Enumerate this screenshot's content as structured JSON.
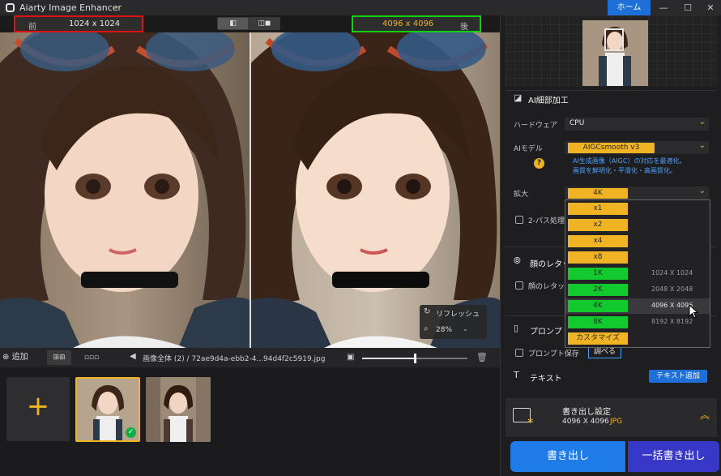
{
  "app": {
    "title": "Aiarty Image Enhancer",
    "home": "ホーム"
  },
  "compare": {
    "before_label": "前",
    "before_res": "1024 x 1024",
    "after_res": "4096 x 4096",
    "after_label": "後"
  },
  "preview": {
    "refresh": "リフレッシュ",
    "zoom": "28%"
  },
  "toolbar": {
    "add": "追加",
    "path": "画像全体 (2)  /  72ae9d4a-ebb2-4...94d4f2c5919.jpg",
    "zoom_slider_fraction": 0.5
  },
  "panel": {
    "ai_section": "AI細部加工",
    "hardware_label": "ハードウェア",
    "hardware_value": "CPU",
    "model_label": "AIモデル",
    "model_value": "AIGCsmooth  v3",
    "model_desc_1": "AI生成画像（AIGC）の対応を最適化。",
    "model_desc_2": "画質を鮮明化・平滑化・高画質化。",
    "scale_label": "拡大",
    "scale_value": "4K",
    "twopass_label": "2-パス処理",
    "face_section": "顔のレタッチ",
    "face_checkbox": "顔のレタッチ",
    "prompt_section": "プロンプト",
    "prompt_save": "プロンプト保存",
    "search": "調べる",
    "text_section": "テキスト",
    "text_add": "テキスト追加"
  },
  "scale_options": [
    {
      "label": "x1",
      "res": "",
      "color": "y"
    },
    {
      "label": "x2",
      "res": "",
      "color": "y"
    },
    {
      "label": "x4",
      "res": "",
      "color": "y"
    },
    {
      "label": "x8",
      "res": "",
      "color": "y"
    },
    {
      "label": "1K",
      "res": "1024 X 1024",
      "color": "g"
    },
    {
      "label": "2K",
      "res": "2048 X 2048",
      "color": "g"
    },
    {
      "label": "4K",
      "res": "4096 X 4096",
      "color": "g"
    },
    {
      "label": "8K",
      "res": "8192 X 8192",
      "color": "g"
    },
    {
      "label": "カスタマイズ",
      "res": "",
      "color": "y"
    }
  ],
  "export": {
    "title": "書き出し設定",
    "res": "4096 X 4096",
    "format": "JPG",
    "export_btn": "書き出し",
    "batch_btn": "一括書き出し"
  }
}
